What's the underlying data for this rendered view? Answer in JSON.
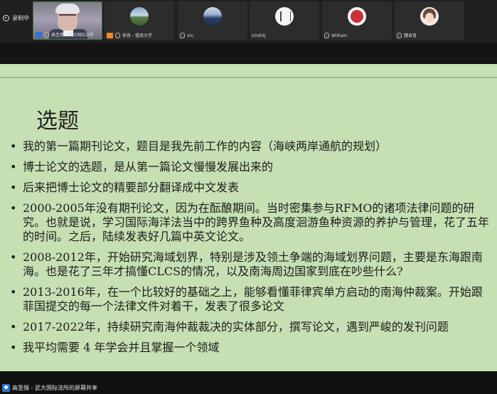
{
  "recording": {
    "label": "录制中"
  },
  "participants": [
    {
      "name": "高圣惕 - 武大国际法所",
      "badge": "host"
    },
    {
      "name": "徐奇 - 暨南大学",
      "badge": "orange"
    },
    {
      "name": "xin"
    },
    {
      "name": "lchshtj"
    },
    {
      "name": "William"
    },
    {
      "name": "魏卓育"
    }
  ],
  "slide": {
    "title": "选题",
    "bullet_marker": "•",
    "bullets": [
      "我的第一篇期刊论文，题目是我先前工作的内容（海峡两岸通航的规划）",
      "博士论文的选题，是从第一篇论文慢慢发展出来的",
      "后来把博士论文的精要部分翻译成中文发表",
      "2000-2005年没有期刊论文，因为在酝酿期间。当时密集参与RFMO的诸项法律问题的研究。也就是说，学习国际海洋法当中的跨界鱼种及高度洄游鱼种资源的养护与管理，花了五年的时间。之后，陆续发表好几篇中英文论文。",
      "2008-2012年，开始研究海域划界，特别是涉及领土争端的海域划界问题，主要是东海跟南海。也是花了三年才搞懂CLCS的情况，以及南海周边国家到底在吵些什么?",
      "2013-2016年，在一个比较好的基础之上，能够看懂菲律宾单方启动的南海仲裁案。开始跟菲国提交的每一个法律文件对着干，发表了很多论文",
      "2017-2022年，持续研究南海仲裁裁决的实体部分，撰写论文，遇到严峻的发刊问题",
      "我平均需要 4 年学会并且掌握一个领域"
    ]
  },
  "share_bar": {
    "label": "高圣惕 - 武大国际法所的屏幕共享"
  }
}
